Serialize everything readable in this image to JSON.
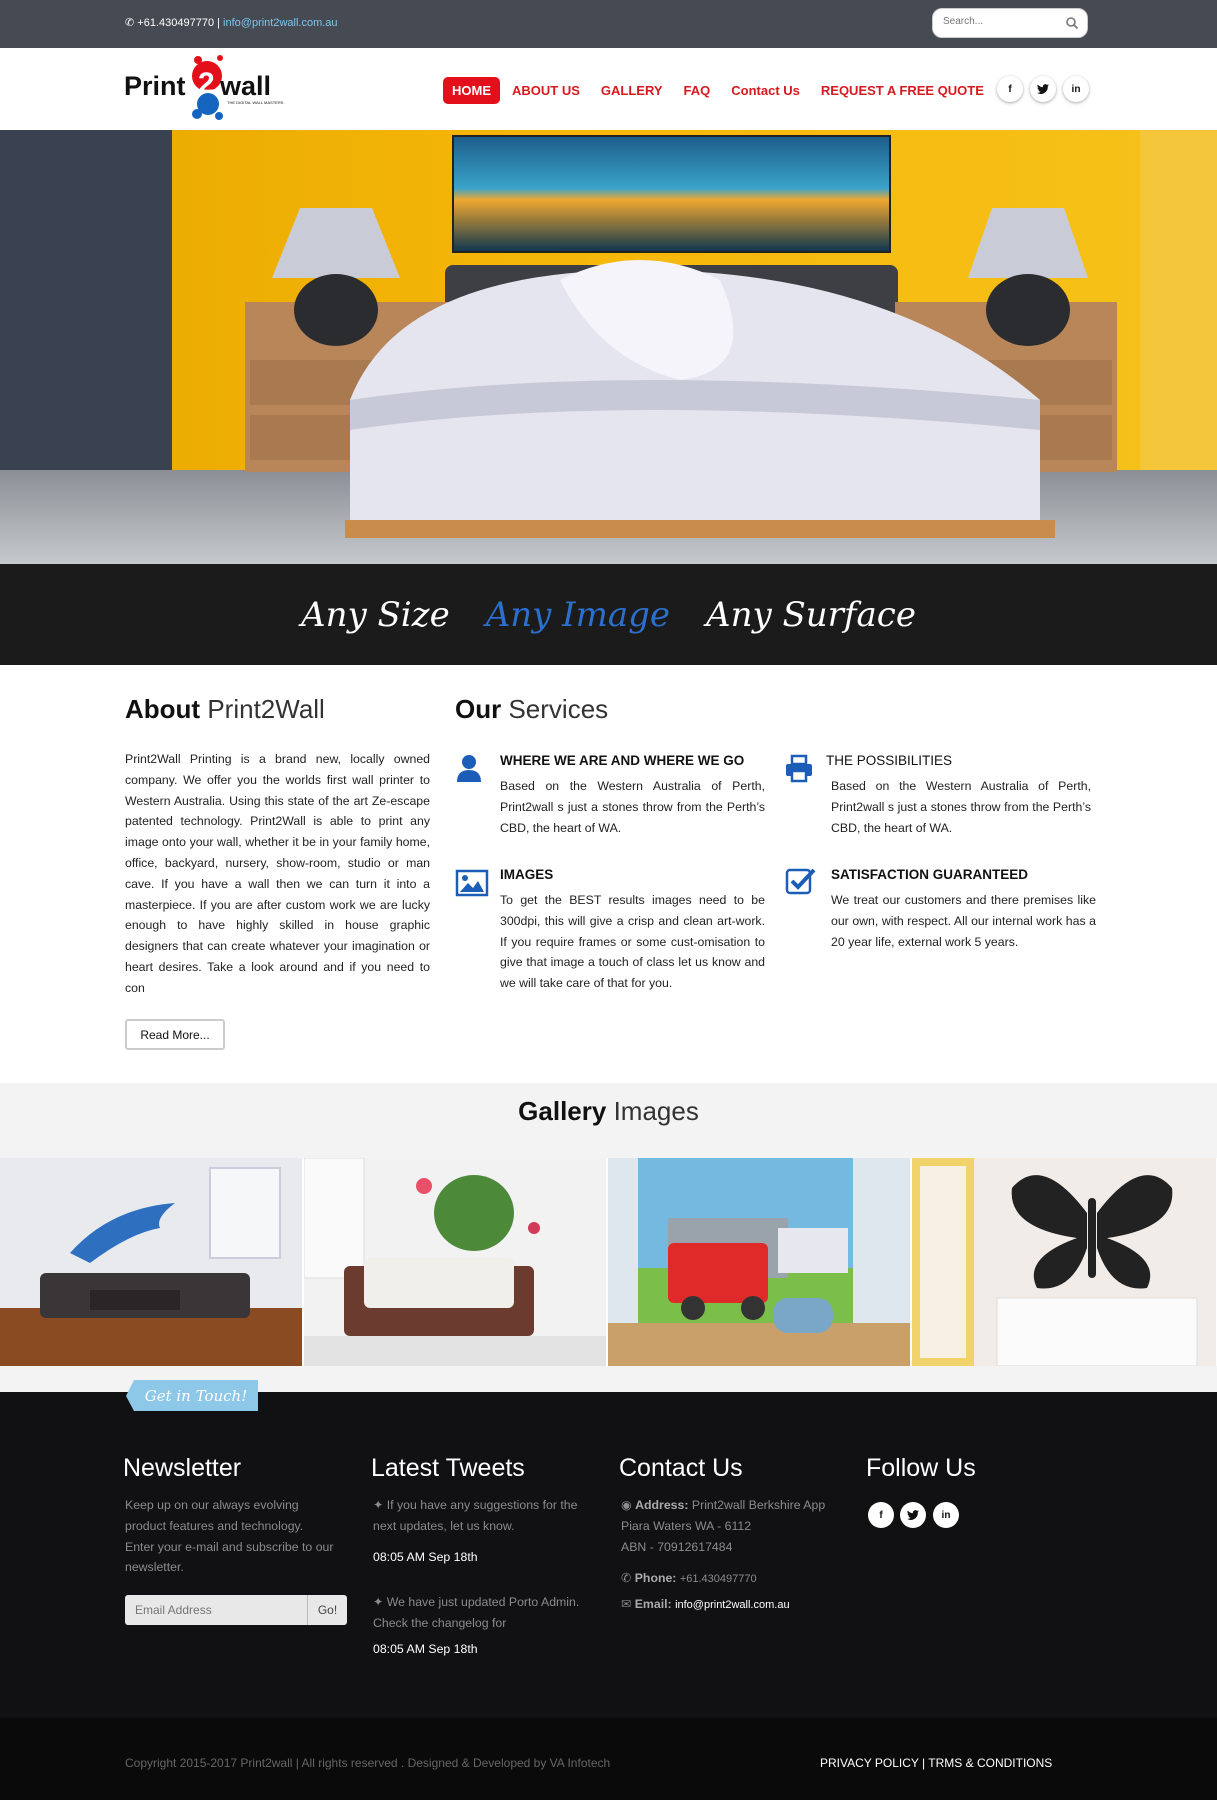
{
  "topbar": {
    "phone": "+61.430497770",
    "separator": " | ",
    "email": "info@print2wall.com.au"
  },
  "search": {
    "placeholder": "Search..."
  },
  "logo": {
    "text": "Print2wall",
    "subtitle": "THE DIGITAL WALL MASTERS"
  },
  "nav": {
    "items": [
      "HOME",
      "ABOUT US",
      "GALLERY",
      "FAQ",
      "Contact Us",
      "REQUEST A FREE QUOTE"
    ],
    "active": "HOME"
  },
  "social": [
    "f",
    "t",
    "in"
  ],
  "tagline": {
    "left": "Any Size",
    "middle": "Any Image",
    "right": "Any Surface"
  },
  "about": {
    "title_bold": "About",
    "title_light": "Print2Wall",
    "text": "Print2Wall Printing is a brand new, locally owned company. We offer you the worlds first wall printer to Western Australia. Using this state of the art Ze-escape patented technology. Print2Wall is able to print any image onto your wall, whether it be in your family home, office, backyard, nursery, show-room, studio or man cave. If you have a wall then we can turn it into a masterpiece. If you are after custom work we are lucky enough to have highly skilled in house graphic designers that can create whatever your imagination or heart desires. Take a look around and if you need to con",
    "read_more": "Read More..."
  },
  "services": {
    "title_bold": "Our",
    "title_light": "Services",
    "items": [
      {
        "title": "WHERE WE ARE AND WHERE WE GO",
        "text": "Based on the Western Australia of Perth, Print2wall s just a stones throw from the Perth’s CBD, the heart of WA.",
        "icon": "user-icon"
      },
      {
        "title": "THE POSSIBILITIES",
        "text": "Based on the Western Australia of Perth, Print2wall s just a stones throw from the Perth’s CBD, the heart of WA.",
        "icon": "printer-icon"
      },
      {
        "title": "IMAGES",
        "text": "To get the BEST results images need to be 300dpi, this will give a crisp and clean art-work. If you require frames or some cust-omisation to give that image a touch of class let us know and we will take care of that for you.",
        "icon": "picture-icon"
      },
      {
        "title": "SATISFACTION GUARANTEED",
        "text": "We treat our customers and there premises like our own, with respect. All our internal work has a 20 year life, external work 5 years.",
        "icon": "check-square-icon"
      }
    ]
  },
  "gallery": {
    "title_bold": "Gallery",
    "title_light": "Images"
  },
  "get_in_touch": "Get in Touch!",
  "footer": {
    "newsletter": {
      "title": "Newsletter",
      "text": "Keep up on our always evolving product features and technology. Enter your e-mail and subscribe to our newsletter.",
      "placeholder": "Email Address",
      "button": "Go!"
    },
    "tweets": {
      "title": "Latest Tweets",
      "items": [
        {
          "text": "If you have any suggestions for the next updates, let us know.",
          "time": "08:05 AM Sep 18th"
        },
        {
          "text": "We have just updated Porto Admin. Check the changelog for",
          "time": "08:05 AM Sep 18th"
        }
      ]
    },
    "contact": {
      "title": "Contact Us",
      "address_label": "Address:",
      "address_line1": "Print2wall Berkshire App",
      "address_line2": "Piara Waters WA - 6112",
      "address_line3": "ABN - 70912617484",
      "phone_label": "Phone:",
      "phone": "+61.430497770",
      "email_label": "Email:",
      "email": "info@print2wall.com.au"
    },
    "follow": {
      "title": "Follow Us"
    }
  },
  "bottom": {
    "copyright": "Copyright 2015-2017 Print2wall | All rights reserved . Designed & Developed by VA Infotech",
    "privacy": "PRIVACY POLICY",
    "sep": " | ",
    "terms": "TRMS & CONDITIONS"
  }
}
